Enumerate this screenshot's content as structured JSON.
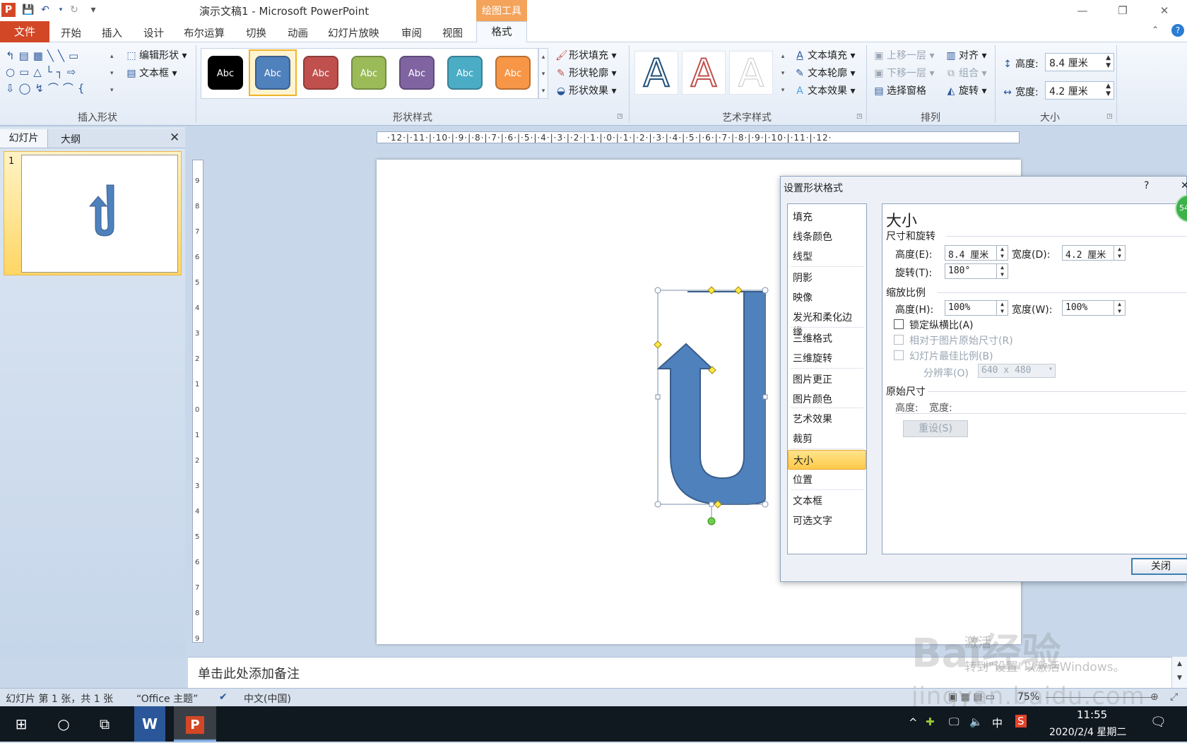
{
  "window": {
    "title": "演示文稿1 - Microsoft PowerPoint",
    "minimize": "—",
    "restore": "❐",
    "close": "✕"
  },
  "qat": {
    "save": "💾",
    "undo": "↶",
    "redo": "↻",
    "more": "▾"
  },
  "tabs": {
    "file": "文件",
    "items": [
      "开始",
      "插入",
      "设计",
      "布尔运算",
      "切换",
      "动画",
      "幻灯片放映",
      "审阅",
      "视图"
    ],
    "context_group": "绘图工具",
    "format": "格式"
  },
  "ribbon": {
    "insert_shapes": {
      "label": "插入形状",
      "edit_shape": "编辑形状",
      "text_box": "文本框"
    },
    "shape_styles": {
      "label": "形状样式",
      "swatches": [
        "Abc",
        "Abc",
        "Abc",
        "Abc",
        "Abc",
        "Abc",
        "Abc"
      ],
      "swatch_colors": [
        "#000000",
        "#4f81bd",
        "#c0504d",
        "#9bbb59",
        "#8064a2",
        "#4bacc6",
        "#f79646"
      ],
      "fill": "形状填充",
      "outline": "形状轮廓",
      "effects": "形状效果"
    },
    "wordart": {
      "label": "艺术字样式",
      "sample": "A",
      "text_fill": "文本填充",
      "text_outline": "文本轮廓",
      "text_effects": "文本效果"
    },
    "arrange": {
      "label": "排列",
      "bring_forward": "上移一层",
      "send_backward": "下移一层",
      "selection_pane": "选择窗格",
      "align": "对齐",
      "group": "组合",
      "rotate": "旋转"
    },
    "size": {
      "label": "大小",
      "height_label": "高度:",
      "height_value": "8.4 厘米",
      "width_label": "宽度:",
      "width_value": "4.2 厘米"
    }
  },
  "left_pane": {
    "tab_slides": "幻灯片",
    "tab_outline": "大纲",
    "slide_number": "1"
  },
  "ruler": {
    "h_ticks": "·12·|·11·|·10·|·9·|·8·|·7·|·6·|·5·|·4·|·3·|·2·|·1·|·0·|·1·|·2·|·3·|·4·|·5·|·6·|·7·|·8·|·9·|·10·|·11·|·12·",
    "v_ticks": [
      "9",
      "8",
      "7",
      "6",
      "5",
      "4",
      "3",
      "2",
      "1",
      "0",
      "1",
      "2",
      "3",
      "4",
      "5",
      "6",
      "7",
      "8",
      "9"
    ]
  },
  "notes": {
    "placeholder": "单击此处添加备注"
  },
  "dialog": {
    "title": "设置形状格式",
    "help": "?",
    "close_x": "✕",
    "nav": [
      "填充",
      "线条颜色",
      "线型",
      "阴影",
      "映像",
      "发光和柔化边缘",
      "三维格式",
      "三维旋转",
      "图片更正",
      "图片颜色",
      "艺术效果",
      "裁剪",
      "大小",
      "位置",
      "文本框",
      "可选文字"
    ],
    "selected": "大小",
    "heading": "大小",
    "section_size_rotate": "尺寸和旋转",
    "height_label": "高度(E):",
    "height_value": "8.4 厘米",
    "width_label": "宽度(D):",
    "width_value": "4.2 厘米",
    "rotation_label": "旋转(T):",
    "rotation_value": "180°",
    "section_scale": "缩放比例",
    "scale_height_label": "高度(H):",
    "scale_height_value": "100%",
    "scale_width_label": "宽度(W):",
    "scale_width_value": "100%",
    "lock_aspect": "锁定纵横比(A)",
    "relative_original": "相对于图片原始尺寸(R)",
    "best_scale": "幻灯片最佳比例(B)",
    "resolution_label": "分辨率(O)",
    "resolution_value": "640 x 480",
    "section_original": "原始尺寸",
    "original_height": "高度:",
    "original_width": "宽度:",
    "reset": "重设(S)",
    "close_button": "关闭"
  },
  "badge": {
    "value": "54"
  },
  "statusbar": {
    "slide_info": "幻灯片 第 1 张，共 1 张",
    "theme": "“Office 主题”",
    "language": "中文(中国)",
    "zoom": "75%"
  },
  "taskbar": {
    "time": "11:55",
    "date": "2020/2/4 星期二",
    "ime": "中"
  },
  "watermark": {
    "brand": "Bai经验",
    "url": "jingyan.baidu.com",
    "activate_line1": "激活",
    "activate_line2": "转到\"设置\"以激活Windows。"
  }
}
